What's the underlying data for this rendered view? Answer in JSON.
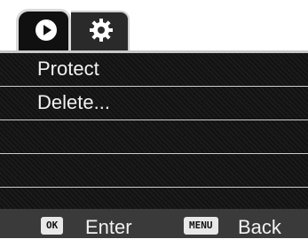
{
  "tabs": [
    {
      "icon": "play-icon",
      "active": true
    },
    {
      "icon": "gear-icon",
      "active": false
    }
  ],
  "menu": {
    "items": [
      {
        "label": "Protect"
      },
      {
        "label": "Delete..."
      },
      {
        "label": ""
      },
      {
        "label": ""
      }
    ]
  },
  "footer": {
    "ok_key": "OK",
    "ok_action": "Enter",
    "menu_key": "MENU",
    "menu_action": "Back"
  },
  "colors": {
    "panel_bg": "#121212",
    "footer_bg": "#3a3a3a",
    "text": "#f2f2f2",
    "divider": "#cdcdcd"
  }
}
